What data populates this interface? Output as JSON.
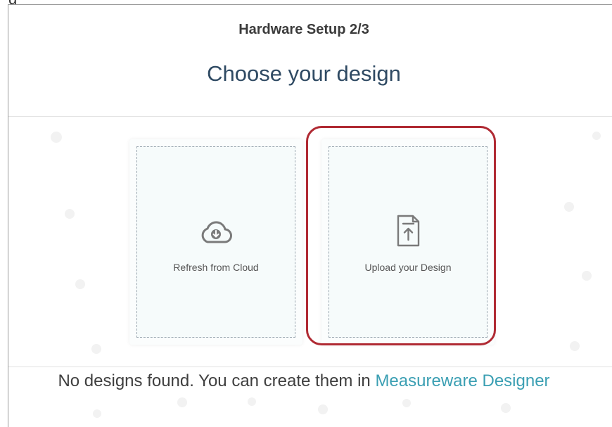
{
  "window": {
    "title_fragment": "g"
  },
  "header": {
    "step_title": "Hardware Setup 2/3",
    "main_title": "Choose your design"
  },
  "options": [
    {
      "label": "Refresh from Cloud",
      "icon": "cloud-download-icon"
    },
    {
      "label": "Upload your Design",
      "icon": "file-upload-icon"
    }
  ],
  "footer": {
    "message": "No designs found. You can create them in ",
    "link_label": "Measureware Designer"
  },
  "colors": {
    "title": "#2f4a63",
    "link": "#3b9fb3",
    "highlight": "#b02a33"
  }
}
